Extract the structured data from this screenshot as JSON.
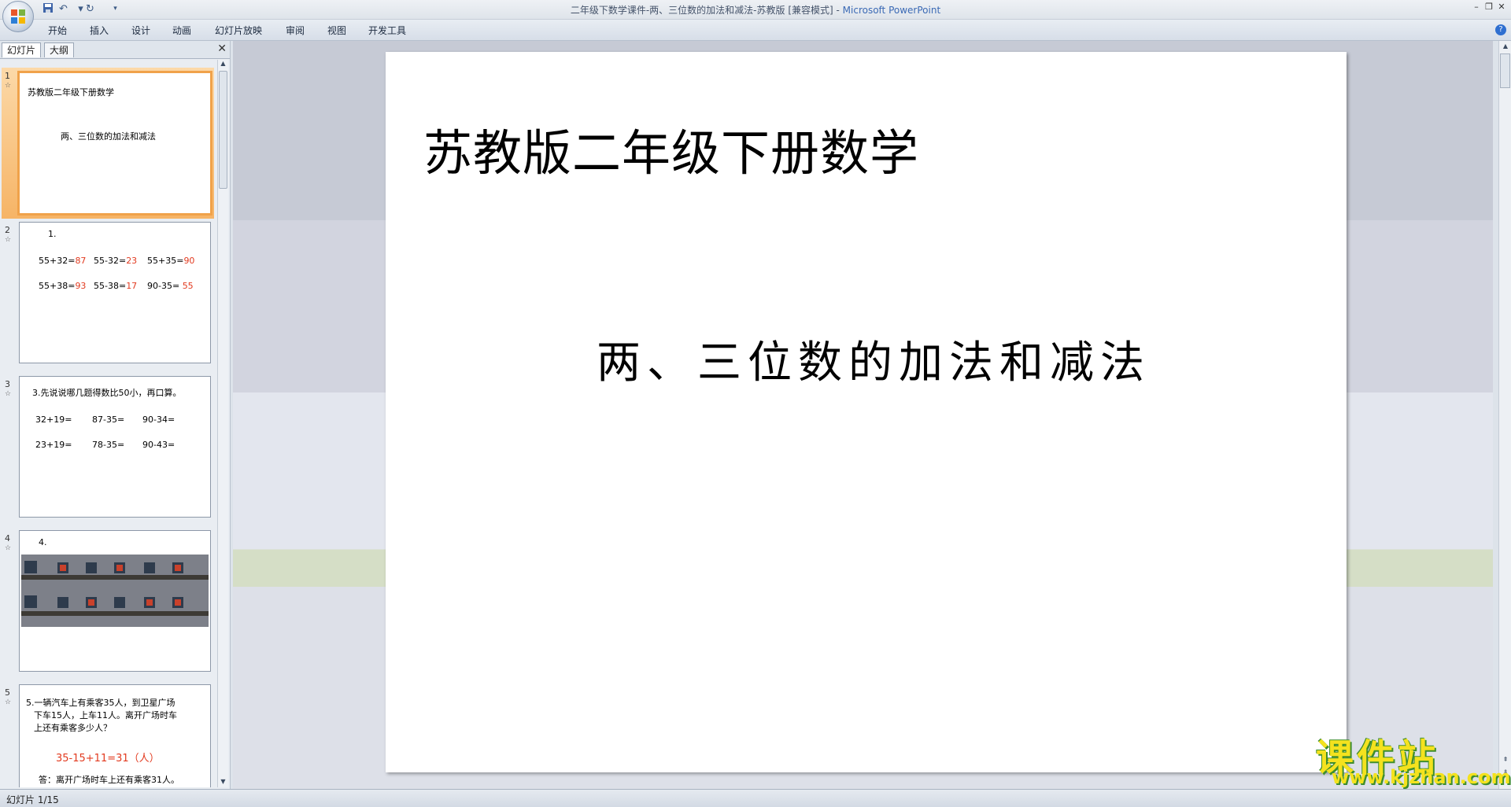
{
  "titlebar": {
    "doc_title": "二年级下数学课件-两、三位数的加法和减法-苏教版 [兼容模式] - ",
    "app_name": "Microsoft PowerPoint"
  },
  "qat": {
    "save_icon": "save-icon",
    "undo_icon": "undo-icon",
    "redo_icon": "redo-icon",
    "more": "▾"
  },
  "ribbon": {
    "tabs": [
      "开始",
      "插入",
      "设计",
      "动画",
      "幻灯片放映",
      "审阅",
      "视图",
      "开发工具"
    ],
    "help": "?"
  },
  "pane": {
    "tabs": [
      "幻灯片",
      "大纲"
    ],
    "close": "✕"
  },
  "slides": [
    {
      "num": "1",
      "line1": "苏教版二年级下册数学",
      "line2": "两、三位数的加法和减法"
    },
    {
      "num": "2",
      "heading": "1.",
      "row1": [
        [
          "55+32=",
          "87"
        ],
        [
          "55-32=",
          "23"
        ],
        [
          "55+35=",
          "90"
        ]
      ],
      "row2": [
        [
          "55+38=",
          "93"
        ],
        [
          "55-38=",
          "17"
        ],
        [
          "90-35=",
          "55"
        ]
      ]
    },
    {
      "num": "3",
      "heading": "3.先说说哪几题得数比50小，再口算。",
      "row1": [
        "32+19=",
        "87-35=",
        "90-34="
      ],
      "row2": [
        "23+19=",
        "78-35=",
        "90-43="
      ]
    },
    {
      "num": "4",
      "heading": "4."
    },
    {
      "num": "5",
      "text1": "5.一辆汽车上有乘客35人，到卫星广场",
      "text2": "下车15人，上车11人。离开广场时车",
      "text3": "上还有乘客多少人？",
      "answer_calc": "35-15+11=31（人）",
      "answer_text": "答：离开广场时车上还有乘客31人。"
    }
  ],
  "current_slide": {
    "title": "苏教版二年级下册数学",
    "subtitle": "两、三位数的加法和减法"
  },
  "watermark": {
    "cn": "课件站",
    "url": "www.kjzhan.com"
  },
  "status": {
    "slide_indicator": "幻灯片 1/15"
  },
  "colors": {
    "answer_red": "#e23a1f",
    "selection_orange": "#f0a24a",
    "accent_blue": "#3b6ab5"
  }
}
